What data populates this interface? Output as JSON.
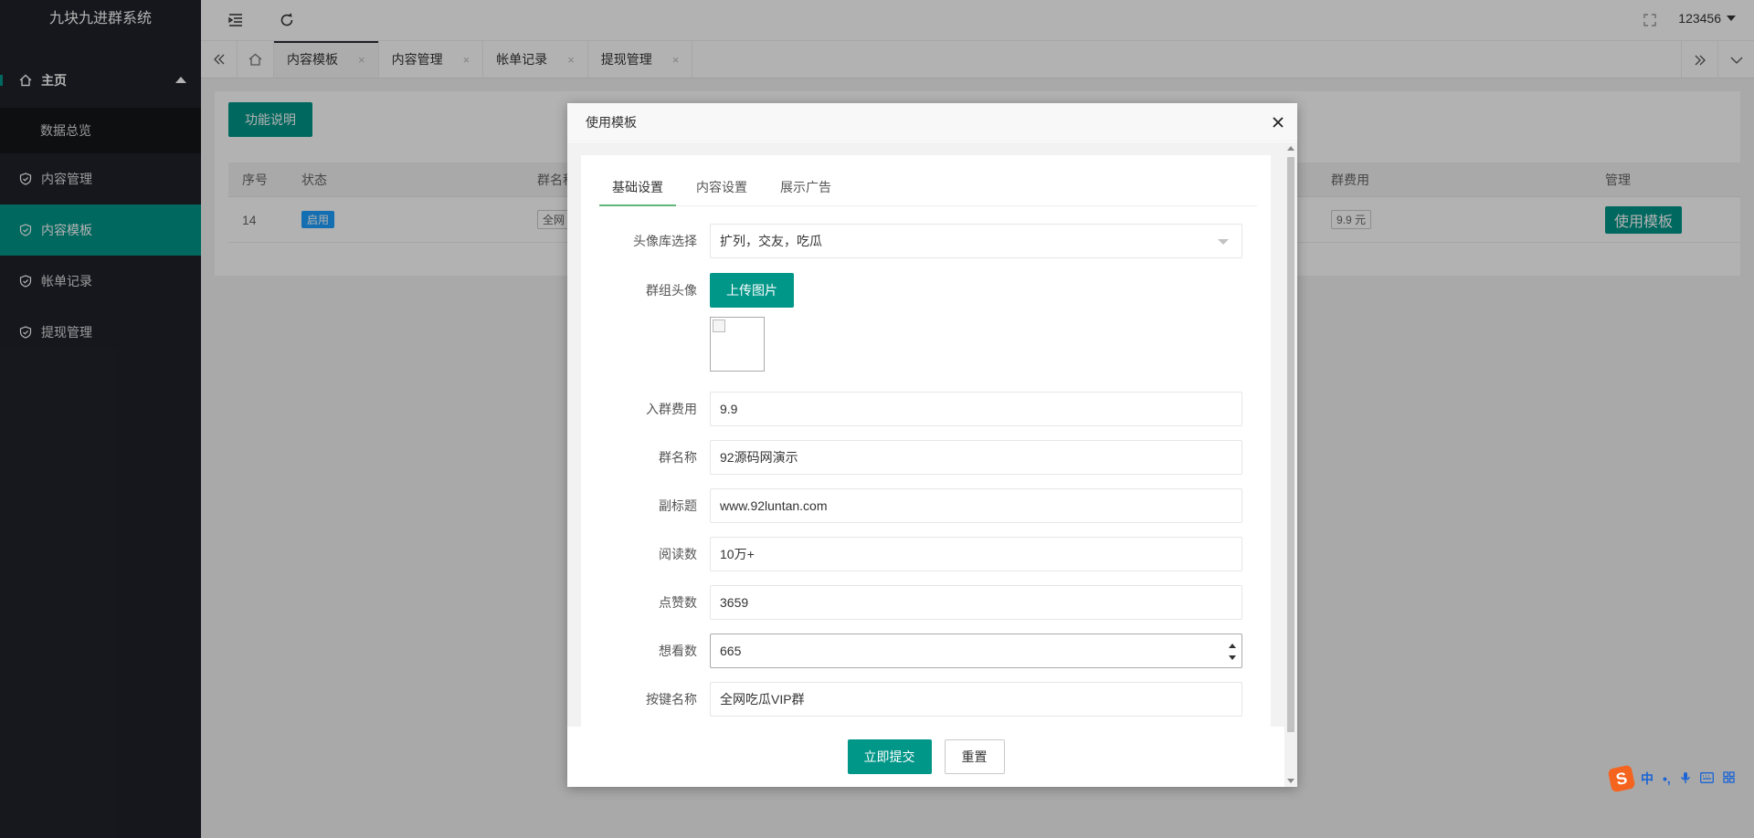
{
  "app": {
    "title": "九块九进群系统"
  },
  "sidebar": {
    "home_label": "主页",
    "submenu_label": "数据总览",
    "items": [
      {
        "label": "内容管理",
        "active": false
      },
      {
        "label": "内容模板",
        "active": true
      },
      {
        "label": "帐单记录",
        "active": false
      },
      {
        "label": "提现管理",
        "active": false
      }
    ]
  },
  "header": {
    "username": "123456"
  },
  "tabs": [
    {
      "label": "内容模板",
      "close": "×",
      "active": true
    },
    {
      "label": "内容管理",
      "close": "×",
      "active": false
    },
    {
      "label": "帐单记录",
      "close": "×",
      "active": false
    },
    {
      "label": "提现管理",
      "close": "×",
      "active": false
    }
  ],
  "content": {
    "func_button": "功能说明",
    "columns": {
      "index": "序号",
      "status": "状态",
      "group": "群名称",
      "fee": "群费用",
      "manage": "管理"
    },
    "row": {
      "index": "14",
      "status": "启用",
      "group": "全网",
      "fee": "9.9 元",
      "action": "使用模板"
    }
  },
  "modal": {
    "title": "使用模板",
    "tabs": [
      "基础设置",
      "内容设置",
      "展示广告"
    ],
    "fields": {
      "avatar_lib": {
        "label": "头像库选择",
        "value": "扩列，交友，吃瓜"
      },
      "group_avatar": {
        "label": "群组头像",
        "upload": "上传图片"
      },
      "fee": {
        "label": "入群费用",
        "value": "9.9"
      },
      "name": {
        "label": "群名称",
        "value": "92源码网演示"
      },
      "subtitle": {
        "label": "副标题",
        "value": "www.92luntan.com"
      },
      "reads": {
        "label": "阅读数",
        "value": "10万+"
      },
      "likes": {
        "label": "点赞数",
        "value": "3659"
      },
      "wants": {
        "label": "想看数",
        "value": "665"
      },
      "button_name": {
        "label": "按键名称",
        "value": "全网吃瓜VIP群"
      }
    },
    "submit": "立即提交",
    "reset": "重置"
  },
  "ime": {
    "logo": "S",
    "lang": "中",
    "punct": "•,"
  },
  "colors": {
    "accent": "#009688",
    "sidebar": "#20222a",
    "badge": "#1e9fff"
  }
}
